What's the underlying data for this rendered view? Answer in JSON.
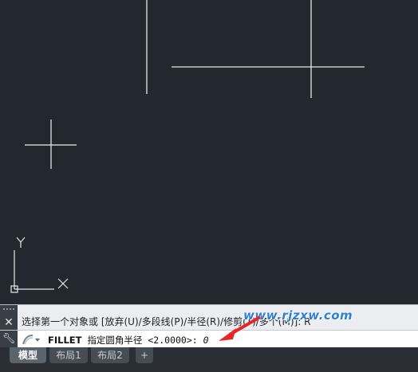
{
  "command_history": {
    "text": "选择第一个对象或 [放弃(U)/多段线(P)/半径(R)/修剪(T)/多个(M)]: R"
  },
  "command_line": {
    "command": "FILLET",
    "prompt": "指定圆角半径",
    "default_value": "<2.0000>:",
    "input": "0"
  },
  "tabs": [
    {
      "label": "模型",
      "active": true
    },
    {
      "label": "布局1",
      "active": false
    },
    {
      "label": "布局2",
      "active": false
    },
    {
      "label": "+",
      "active": false
    }
  ],
  "ucs": {
    "x_label": "X",
    "y_label": "Y"
  },
  "watermark": "www.rjzxw.com",
  "colors": {
    "canvas": "#212830",
    "lines": "#e8e8e8",
    "annotation_arrow": "#e8262a",
    "watermark": "#2f7fd6"
  }
}
